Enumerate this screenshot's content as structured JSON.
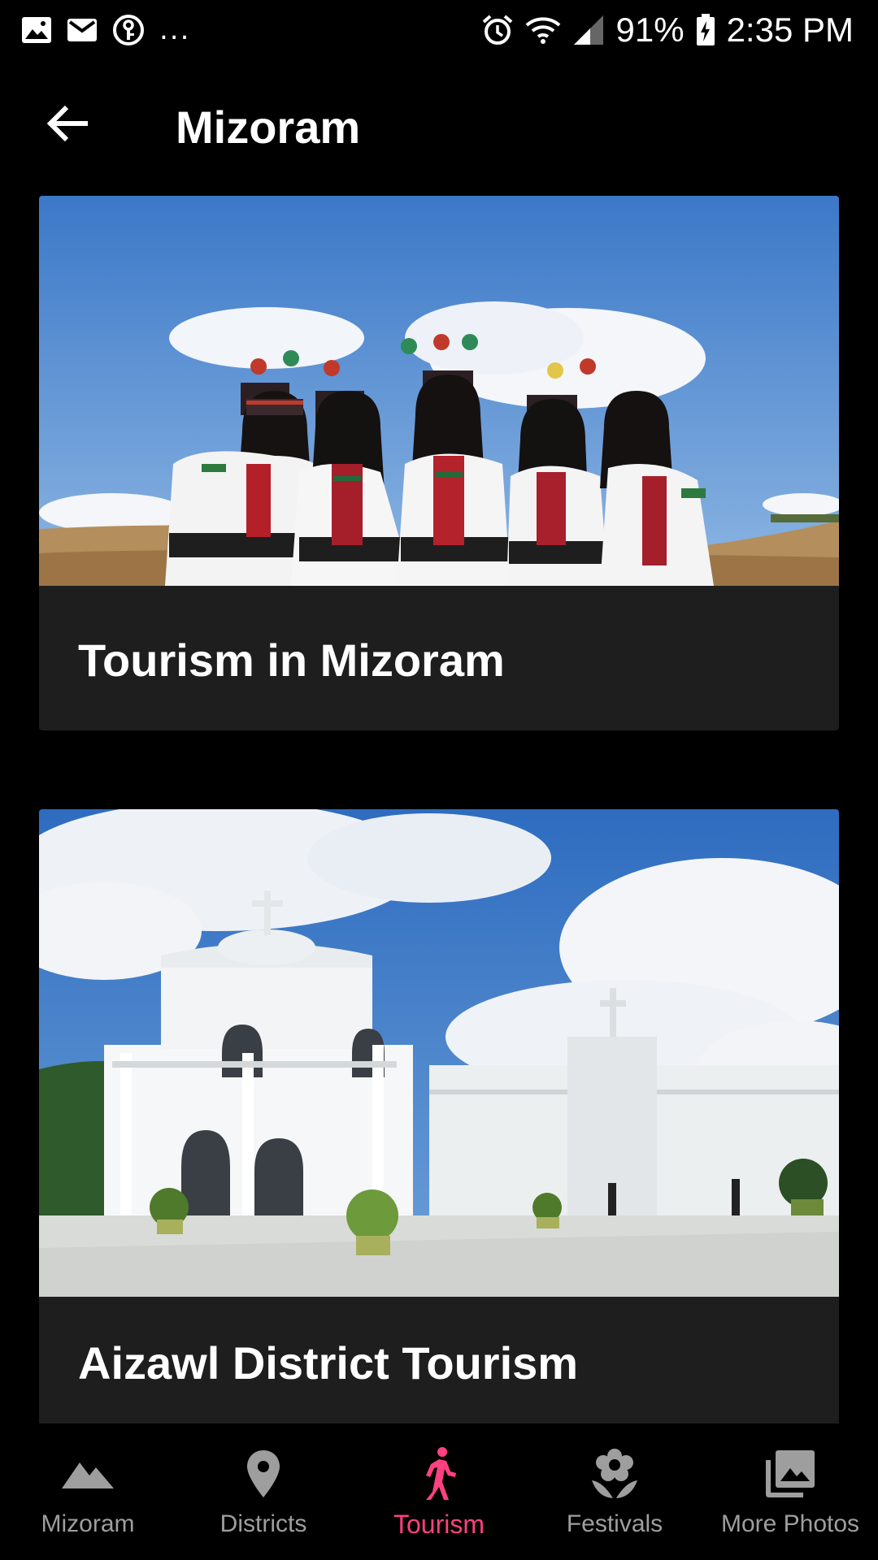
{
  "status_bar": {
    "left_icons": [
      "gallery-icon",
      "gmail-icon",
      "vpn-key-icon"
    ],
    "more": "...",
    "right_icons": [
      "alarm-icon",
      "wifi-icon",
      "cell-signal-icon",
      "battery-charging-icon"
    ],
    "battery": "91%",
    "time": "2:35 PM"
  },
  "app_bar": {
    "back_icon": "arrow-back-icon",
    "title": "Mizoram"
  },
  "cards": [
    {
      "image": "women-in-traditional-mizo-dress-photo",
      "title": "Tourism in Mizoram"
    },
    {
      "image": "white-church-aizawl-photo",
      "title": "Aizawl District Tourism"
    }
  ],
  "bottom_nav": {
    "items": [
      {
        "label": "Mizoram",
        "icon": "mountain-icon",
        "active": false
      },
      {
        "label": "Districts",
        "icon": "location-pin-icon",
        "active": false
      },
      {
        "label": "Tourism",
        "icon": "walking-person-icon",
        "active": true
      },
      {
        "label": "Festivals",
        "icon": "flower-icon",
        "active": false
      },
      {
        "label": "More Photos",
        "icon": "photo-library-icon",
        "active": false
      }
    ]
  },
  "colors": {
    "background": "#000000",
    "card": "#1e1e1e",
    "accent": "#ff4081",
    "inactive": "#9e9e9e"
  }
}
